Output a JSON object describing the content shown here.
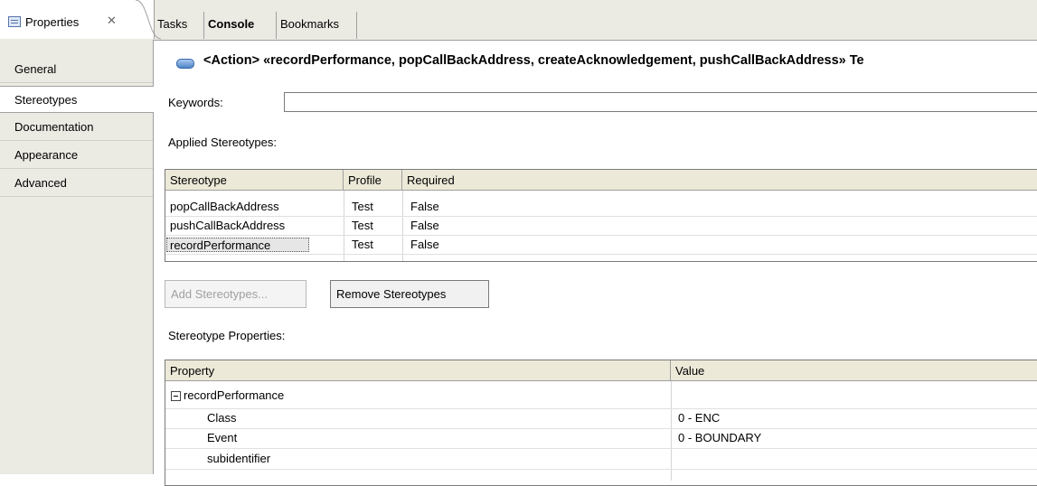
{
  "tabs": {
    "properties": "Properties",
    "properties_close": "✕",
    "tasks": "Tasks",
    "console": "Console",
    "bookmarks": "Bookmarks"
  },
  "sidebar": {
    "items": [
      {
        "label": "General"
      },
      {
        "label": "Stereotypes"
      },
      {
        "label": "Documentation"
      },
      {
        "label": "Appearance"
      },
      {
        "label": "Advanced"
      }
    ]
  },
  "header": {
    "title": "<Action> «recordPerformance, popCallBackAddress, createAcknowledgement, pushCallBackAddress» Te"
  },
  "keywords": {
    "label": "Keywords:",
    "value": ""
  },
  "applied": {
    "label": "Applied Stereotypes:",
    "columns": [
      "Stereotype",
      "Profile",
      "Required"
    ],
    "rows": [
      {
        "stereotype": "popCallBackAddress",
        "profile": "Test",
        "required": "False"
      },
      {
        "stereotype": "pushCallBackAddress",
        "profile": "Test",
        "required": "False"
      },
      {
        "stereotype": "recordPerformance",
        "profile": "Test",
        "required": "False"
      }
    ]
  },
  "buttons": {
    "add": "Add Stereotypes...",
    "remove": "Remove Stereotypes"
  },
  "stereo_props": {
    "label": "Stereotype Properties:",
    "columns": [
      "Property",
      "Value"
    ],
    "group": "recordPerformance",
    "rows": [
      {
        "property": "Class",
        "value": "0 - ENC"
      },
      {
        "property": "Event",
        "value": "0 - BOUNDARY"
      },
      {
        "property": "subidentifier",
        "value": ""
      }
    ]
  }
}
